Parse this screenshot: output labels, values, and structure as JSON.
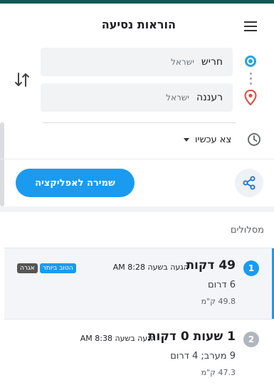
{
  "header": {
    "title": "הוראות נסיעה"
  },
  "from": {
    "value": "חריש",
    "sublabel": "ישראל"
  },
  "to": {
    "value": "רעננה",
    "sublabel": "ישראל"
  },
  "depart": {
    "selected": "צא עכשיו"
  },
  "actions": {
    "save_label": "שמירה לאפליקציה"
  },
  "routes": {
    "header": "מסלולים",
    "items": [
      {
        "index": "1",
        "duration": "49 דקות",
        "arrival": "הגעה בשעה 8:28 AM",
        "badges": [
          "הטוב ביותר",
          "אגרה"
        ],
        "description": "6 דרום",
        "distance": "49.8 ק\"מ"
      },
      {
        "index": "2",
        "duration": "1 שעות 0 דקות",
        "arrival": "הגעה בשעה 8:38 AM",
        "badges": [],
        "description": "9 מערב; 4 דרום",
        "distance": "47.3 ק\"מ"
      }
    ]
  },
  "colors": {
    "accent": "#1a9bf0",
    "top_bar": "#0e5a56",
    "origin_marker": "#2aa4d8",
    "destination_marker": "#e8453c",
    "toll_badge": "#555555"
  },
  "icons": {
    "menu": "menu-icon",
    "origin": "origin-marker-icon",
    "destination": "destination-pin-icon",
    "swap": "swap-icon",
    "clock": "clock-icon",
    "share": "share-icon"
  }
}
